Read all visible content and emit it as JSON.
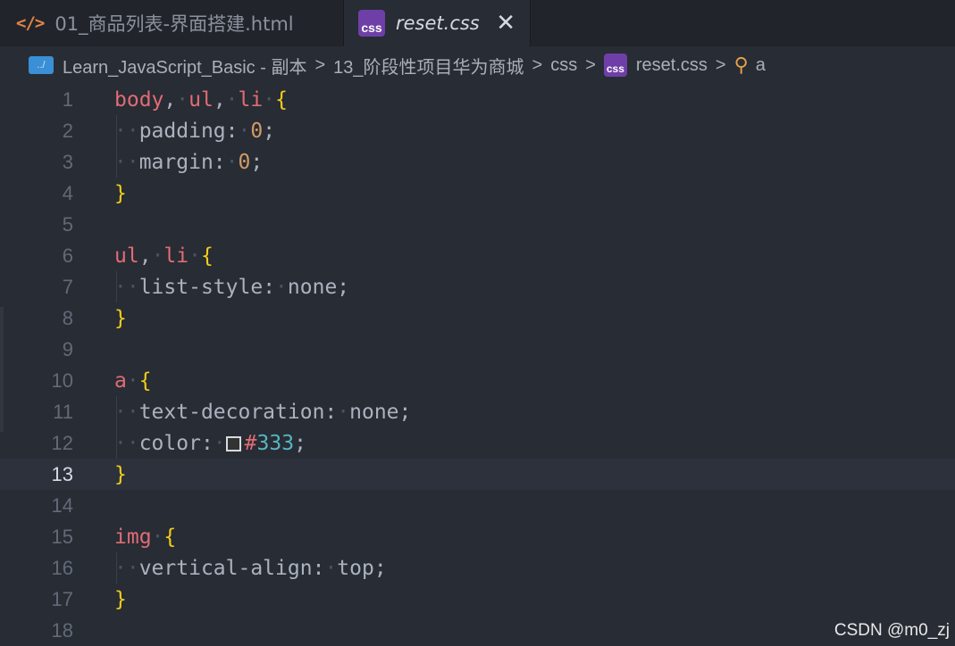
{
  "tabs": [
    {
      "icon": "</>",
      "label": "01_商品列表-界面搭建.html",
      "active": false
    },
    {
      "icon": "css",
      "label": "reset.css",
      "active": true,
      "close": "✕"
    }
  ],
  "breadcrumb": {
    "root_icon": "../",
    "items": [
      "Learn_JavaScript_Basic - 副本",
      "13_阶段性项目华为商城",
      "css"
    ],
    "file_icon": "css",
    "file": "reset.css",
    "symbol": "a",
    "separator": ">"
  },
  "editor": {
    "current_line": 13,
    "line_numbers": [
      "1",
      "2",
      "3",
      "4",
      "5",
      "6",
      "7",
      "8",
      "9",
      "10",
      "11",
      "12",
      "13",
      "14",
      "15",
      "16",
      "17",
      "18"
    ],
    "code": {
      "l1_sel1": "body",
      "l1_sel2": "ul",
      "l1_sel3": "li",
      "l2_prop": "padding",
      "l2_val": "0",
      "l3_prop": "margin",
      "l3_val": "0",
      "l6_sel1": "ul",
      "l6_sel2": "li",
      "l7_prop": "list-style",
      "l7_val": "none",
      "l10_sel": "a",
      "l11_prop": "text-decoration",
      "l11_val": "none",
      "l12_prop": "color",
      "l12_hash": "#",
      "l12_val": "333",
      "l15_sel": "img",
      "l16_prop": "vertical-align",
      "l16_val": "top",
      "open_brace": "{",
      "close_brace": "}",
      "comma": ",",
      "colon": ":",
      "semicolon": ";"
    }
  },
  "colors": {
    "selector": "#e06c75",
    "brace": "#f2cd1c",
    "number": "#d19a66",
    "hex": "#56b6c2",
    "swatch": "#333333"
  },
  "watermark": "CSDN @m0_zj"
}
